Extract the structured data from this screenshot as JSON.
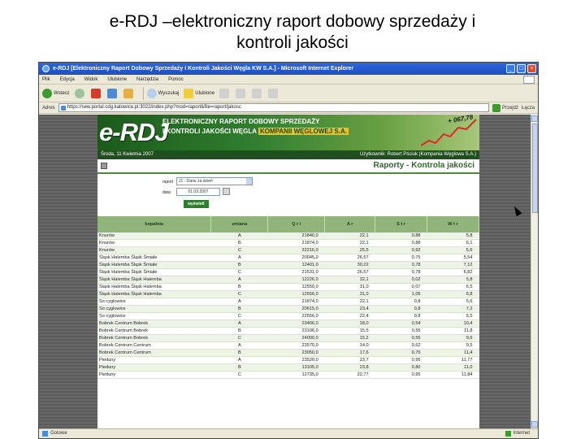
{
  "slide": {
    "title_line1": "e-RDJ –elektroniczny raport dobowy sprzedaży i",
    "title_line2": "kontroli jakości"
  },
  "browser": {
    "window_title": "e-RDJ [Elektroniczny Raport Dobowy Sprzedaży i Kontroli Jakości Węgla KW S.A.] - Microsoft Internet Explorer",
    "menu": [
      "Plik",
      "Edycja",
      "Widok",
      "Ulubione",
      "Narzędzia",
      "Pomoc"
    ],
    "toolbar": {
      "back": "Wstecz",
      "search": "Wyszukaj",
      "favorites": "Ulubione"
    },
    "address_label": "Adres",
    "address_value": "https://sew.portal.cdg.katowice.pl:3022/index.php?mod=raport&file=raport/jakosc",
    "go_label": "Przejdź",
    "links_label": "Łącza",
    "status_left": "Gotowe",
    "status_zone": "Internet"
  },
  "page": {
    "logo": "e-RDJ",
    "banner_line1": "ELEKTRONICZNY RAPORT DOBOWY SPRZEDAŻY",
    "banner_line2": "I KONTROLI JAKOŚCI WĘGLA",
    "banner_company": "KOMPANII WĘGLOWEJ S.A.",
    "banner_ticker": "+ 067,78",
    "date_text": "Środa, 11 Kwietnia 2007",
    "user_text": "Użytkownik: Robert Pściuk (Kompania Węglowa S.A.)",
    "report_title": "Raporty - Kontrola jakości",
    "form": {
      "raport_label": "raport",
      "raport_value": "J1 - Dane za dzień",
      "data_label": "data",
      "data_value": "01.03.2007",
      "show_button": "wyświetl"
    },
    "table": {
      "headers": [
        "kopalnia",
        "zmiana",
        "Q r i",
        "A r",
        "S t r",
        "W t r"
      ],
      "rows": [
        [
          "Knurów",
          "A",
          "21840,0",
          "22,1",
          "0,88",
          "5,8"
        ],
        [
          "Knurów",
          "B",
          "21874,0",
          "22,1",
          "0,88",
          "6,1"
        ],
        [
          "Knurów",
          "C",
          "22216,0",
          "25,5",
          "0,92",
          "5,6"
        ],
        [
          "Śląsk Halemba Śląsk Śmiałe",
          "A",
          "20045,0",
          "26,57",
          "0,75",
          "5,54"
        ],
        [
          "Śląsk Halemba Śląsk Śmiałe",
          "B",
          "12401,0",
          "30,22",
          "0,78",
          "7,12"
        ],
        [
          "Śląsk Halemba Śląsk Śmiałe",
          "C",
          "21531,0",
          "26,57",
          "0,78",
          "6,82"
        ],
        [
          "Śląsk Halemba Śląsk Halemba",
          "A",
          "12226,0",
          "32,1",
          "0,02",
          "5,8"
        ],
        [
          "Śląsk Halemba Śląsk Halemba",
          "B",
          "12550,0",
          "31,0",
          "0,07",
          "6,5"
        ],
        [
          "Śląsk Halemba Śląsk Halemba",
          "C",
          "12656,0",
          "31,0",
          "1,05",
          "6,8"
        ],
        [
          "So cyglowice",
          "A",
          "21874,0",
          "22,1",
          "0,8",
          "5,6"
        ],
        [
          "So cyglowice",
          "B",
          "20615,0",
          "23,4",
          "0,8",
          "7,2"
        ],
        [
          "So cyglowice",
          "C",
          "22556,0",
          "22,4",
          "0,8",
          "5,5"
        ],
        [
          "Bobrek Centrum Bobrek",
          "A",
          "23406,0",
          "18,0",
          "0,54",
          "10,4"
        ],
        [
          "Bobrek Centrum Bobrek",
          "B",
          "23106,0",
          "15,5",
          "0,55",
          "11,8"
        ],
        [
          "Bobrek Centrum Bobrek",
          "C",
          "24000,0",
          "15,2",
          "0,55",
          "9,6"
        ],
        [
          "Bobrek Centrum Centrum",
          "A",
          "23570,0",
          "14,0",
          "0,62",
          "9,5"
        ],
        [
          "Bobrek Centrum Centrum",
          "B",
          "23050,0",
          "17,6",
          "0,70",
          "11,4"
        ],
        [
          "Pieduny",
          "A",
          "23520,0",
          "23,7",
          "0,95",
          "11,77"
        ],
        [
          "Pieduny",
          "B",
          "13105,0",
          "23,8",
          "0,80",
          "11,0"
        ],
        [
          "Pieduny",
          "C",
          "12735,0",
          "22,77",
          "0,95",
          "11,84"
        ]
      ]
    }
  }
}
